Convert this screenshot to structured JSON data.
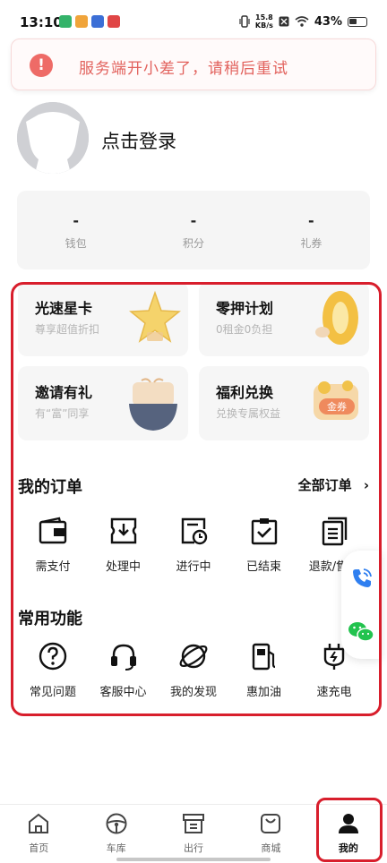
{
  "status_bar": {
    "time": "13:10",
    "net_speed_value": "15.8",
    "net_speed_unit": "KB/s",
    "battery": "43%",
    "icons": [
      "vibrate-icon",
      "nfc-icon",
      "wifi-icon",
      "battery-icon"
    ]
  },
  "toast": {
    "icon": "!",
    "message": "服务端开小差了，请稍后重试"
  },
  "profile": {
    "login_label": "点击登录"
  },
  "stats": [
    {
      "value": "-",
      "label": "钱包"
    },
    {
      "value": "-",
      "label": "积分"
    },
    {
      "value": "-",
      "label": "礼券"
    }
  ],
  "promos": [
    {
      "title": "光速星卡",
      "subtitle": "尊享超值折扣",
      "art": "star-icon"
    },
    {
      "title": "零押计划",
      "subtitle": "0租金0负担",
      "art": "gold-zero-icon"
    },
    {
      "title": "邀请有礼",
      "subtitle": "有“富”同享",
      "art": "gift-bag-icon"
    },
    {
      "title": "福利兑换",
      "subtitle": "兑换专属权益",
      "art": "coupon-wallet-icon",
      "badge": "金券"
    }
  ],
  "orders": {
    "title": "我的订单",
    "all_link": "全部订单",
    "items": [
      {
        "label": "需支付",
        "icon": "wallet-icon"
      },
      {
        "label": "处理中",
        "icon": "ticket-icon"
      },
      {
        "label": "进行中",
        "icon": "clock-doc-icon"
      },
      {
        "label": "已结束",
        "icon": "check-clipboard-icon"
      },
      {
        "label": "退款/售后",
        "icon": "refund-doc-icon"
      }
    ]
  },
  "functions": {
    "title": "常用功能",
    "items": [
      {
        "label": "常见问题",
        "icon": "question-icon"
      },
      {
        "label": "客服中心",
        "icon": "headset-icon"
      },
      {
        "label": "我的发现",
        "icon": "planet-icon"
      },
      {
        "label": "惠加油",
        "icon": "fuel-icon"
      },
      {
        "label": "速充电",
        "icon": "charger-icon"
      }
    ]
  },
  "tabs": [
    {
      "label": "首页",
      "icon": "home-icon"
    },
    {
      "label": "车库",
      "icon": "steering-wheel-icon"
    },
    {
      "label": "出行",
      "icon": "archive-icon"
    },
    {
      "label": "商城",
      "icon": "shopping-bag-icon"
    },
    {
      "label": "我的",
      "icon": "user-icon",
      "active": true
    }
  ],
  "colors": {
    "accent_red": "#d81e2c",
    "toast_text": "#e2625d",
    "phone_blue": "#2f7ff0",
    "wechat_green": "#22c34e"
  }
}
